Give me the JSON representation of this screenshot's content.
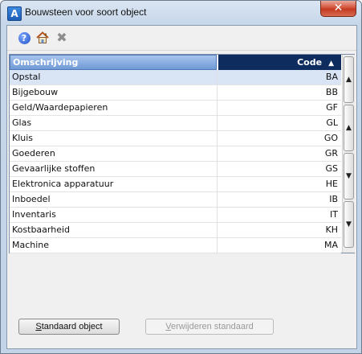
{
  "window": {
    "title": "Bouwsteen voor soort object",
    "close_glyph": "✕"
  },
  "toolbar": {
    "icons": [
      "help-icon",
      "home-icon",
      "close-icon"
    ],
    "help_glyph": "?",
    "close_glyph": "✖"
  },
  "grid": {
    "headers": {
      "description": "Omschrijving",
      "code": "Code",
      "sort_glyph": "▲"
    },
    "rows": [
      {
        "description": "Opstal",
        "code": "BA",
        "selected": true
      },
      {
        "description": "Bijgebouw",
        "code": "BB"
      },
      {
        "description": "Geld/Waardepapieren",
        "code": "GF"
      },
      {
        "description": "Glas",
        "code": "GL"
      },
      {
        "description": "Kluis",
        "code": "GO"
      },
      {
        "description": "Goederen",
        "code": "GR"
      },
      {
        "description": "Gevaarlijke stoffen",
        "code": "GS"
      },
      {
        "description": "Elektronica apparatuur",
        "code": "HE"
      },
      {
        "description": "Inboedel",
        "code": "IB"
      },
      {
        "description": "Inventaris",
        "code": "IT"
      },
      {
        "description": "Kostbaarheid",
        "code": "KH"
      },
      {
        "description": "Machine",
        "code": "MA"
      }
    ],
    "scroll": {
      "up": "▲",
      "down": "▼"
    }
  },
  "buttons": {
    "standaard_object": {
      "mnemonic": "S",
      "rest": "tandaard object"
    },
    "verwijderen_standaard": {
      "mnemonic": "V",
      "rest": "erwijderen standaard"
    }
  }
}
